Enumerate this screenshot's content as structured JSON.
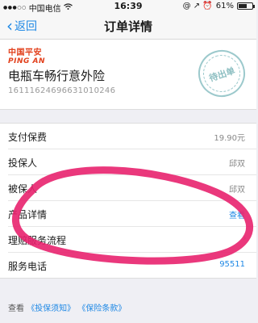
{
  "status_bar": {
    "signal": "●●●○○",
    "carrier": "中国电信",
    "wifi": "wifi-icon",
    "time": "16:39",
    "right_icons": "@ ↗ ⏰",
    "battery_text": "61%",
    "battery_level": 0.61
  },
  "nav": {
    "back_label": "返回",
    "title": "订单详情"
  },
  "policy": {
    "brand_cn": "中国平安",
    "brand_en": "PING AN",
    "product_name": "电瓶车畅行意外险",
    "policy_number": "16111624696631010246",
    "stamp_text": "待出单"
  },
  "rows": [
    {
      "label": "支付保费",
      "value": "19.90元"
    },
    {
      "label": "投保人",
      "value": "邱双"
    },
    {
      "label": "被保人",
      "value": "邱双"
    },
    {
      "label": "产品详情",
      "value": "查看"
    },
    {
      "label": "理赔服务流程",
      "value": ""
    },
    {
      "label": "服务电话",
      "value": "95511"
    }
  ],
  "footer": {
    "prefix": "查看",
    "link1": "《投保须知》",
    "link2": "《保险条款》"
  },
  "colors": {
    "accent": "#1e88e5",
    "brand": "#e2401c",
    "annotation": "#e8226e"
  }
}
